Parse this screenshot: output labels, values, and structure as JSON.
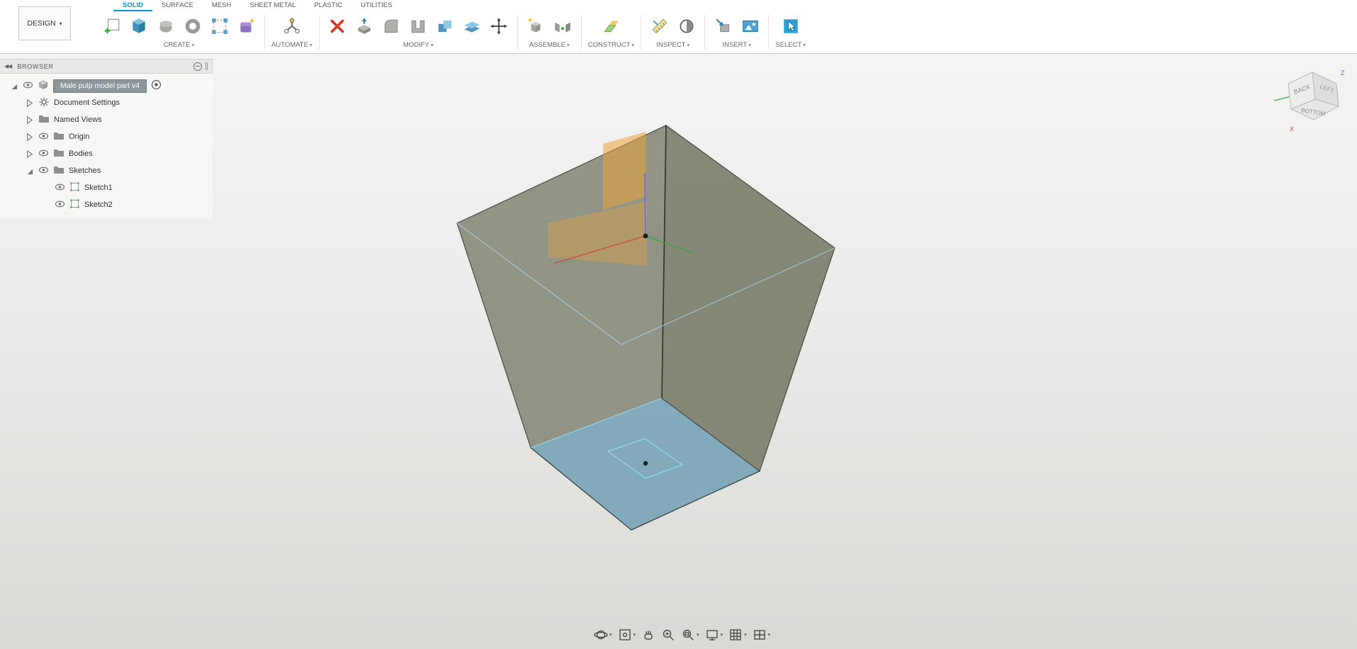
{
  "design_menu": {
    "label": "DESIGN"
  },
  "tabs": [
    {
      "label": "SOLID",
      "active": true
    },
    {
      "label": "SURFACE",
      "active": false
    },
    {
      "label": "MESH",
      "active": false
    },
    {
      "label": "SHEET METAL",
      "active": false
    },
    {
      "label": "PLASTIC",
      "active": false
    },
    {
      "label": "UTILITIES",
      "active": false
    }
  ],
  "toolbar": {
    "groups": [
      {
        "label": "CREATE",
        "icons": [
          "create-sketch",
          "extrude",
          "revolve",
          "sweep",
          "rectangular-pattern",
          "create-form"
        ]
      },
      {
        "label": "AUTOMATE",
        "icons": [
          "scripts-addins"
        ]
      },
      {
        "label": "MODIFY",
        "icons": [
          "delete",
          "press-pull",
          "fillet",
          "shell",
          "combine",
          "offset-face",
          "move-copy"
        ]
      },
      {
        "label": "ASSEMBLE",
        "icons": [
          "new-component",
          "joint"
        ]
      },
      {
        "label": "CONSTRUCT",
        "icons": [
          "construction-plane"
        ]
      },
      {
        "label": "INSPECT",
        "icons": [
          "measure",
          "section-analysis"
        ]
      },
      {
        "label": "INSERT",
        "icons": [
          "insert-derive",
          "canvas"
        ]
      },
      {
        "label": "SELECT",
        "icons": [
          "select"
        ]
      }
    ]
  },
  "browser": {
    "title": "BROWSER",
    "rows": [
      {
        "label": "Male pulp model part v4",
        "type": "component-root",
        "selected": true
      },
      {
        "label": "Document Settings",
        "type": "settings"
      },
      {
        "label": "Named Views",
        "type": "folder"
      },
      {
        "label": "Origin",
        "type": "folder"
      },
      {
        "label": "Bodies",
        "type": "folder"
      },
      {
        "label": "Sketches",
        "type": "folder",
        "expanded": true
      },
      {
        "label": "Sketch1",
        "type": "sketch"
      },
      {
        "label": "Sketch2",
        "type": "sketch"
      }
    ]
  },
  "viewcube": {
    "face_back": "BACK",
    "face_left": "LEFT",
    "face_bottom": "BOTTOM",
    "axis_x": "X",
    "axis_z": "Z"
  },
  "navbar": {
    "icons": [
      "orbit",
      "look-at",
      "pan",
      "zoom",
      "zoom-window",
      "display-settings",
      "grid-and-snaps",
      "viewports"
    ]
  },
  "colors": {
    "accent_blue": "#0696d7",
    "selected_face": "#7ba6b8",
    "body_face": "#8b8e7e",
    "highlight_edge": "#8fd0ea",
    "origin_plane": "#e8a33d"
  }
}
